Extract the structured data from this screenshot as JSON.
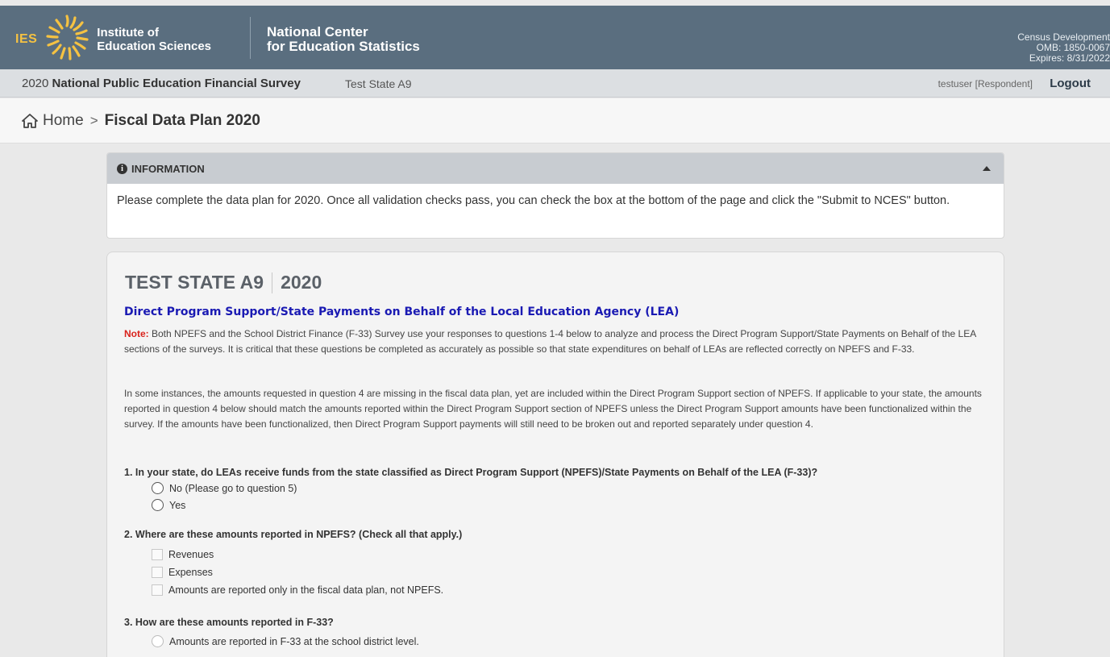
{
  "header": {
    "ies_letters": "IES",
    "ies_line1": "Institute of",
    "ies_line2": "Education Sciences",
    "nces_line1": "National Center",
    "nces_line2": "for Education Statistics",
    "omb_line1": "Census Development",
    "omb_line2": "OMB: 1850-0067",
    "omb_line3": "Expires: 8/31/2022",
    "brand_color": "#5a6e7f",
    "sun_color": "#f5c242"
  },
  "subbar": {
    "survey_year": "2020",
    "survey_name": "National Public Education Financial Survey",
    "state": "Test State A9",
    "user": "testuser [Respondent]",
    "logout": "Logout"
  },
  "breadcrumb": {
    "home": "Home",
    "separator": ">",
    "current": "Fiscal Data Plan 2020"
  },
  "info_panel": {
    "title": "INFORMATION",
    "text": "Please complete the data plan for 2020. Once all validation checks pass, you can check the box at the bottom of the page and click the \"Submit to NCES\" button."
  },
  "main": {
    "state_title": "TEST STATE A9",
    "year": "2020",
    "section_title": "Direct Program Support/State Payments on Behalf of the Local Education Agency (LEA)",
    "note_label": "Note:",
    "note_text": " Both NPEFS and the School District Finance (F-33) Survey use your responses to questions 1-4 below to analyze and process the Direct Program Support/State Payments on Behalf of the LEA sections of the surveys. It is critical that these questions be completed as accurately as possible so that state expenditures on behalf of LEAs are reflected correctly on NPEFS and F-33.",
    "paragraph2": "In some instances, the amounts requested in question 4 are missing in the fiscal data plan, yet are included within the Direct Program Support section of NPEFS. If applicable to your state, the amounts reported in question 4 below should match the amounts reported within the Direct Program Support section of NPEFS unless the Direct Program Support amounts have been functionalized within the survey. If the amounts have been functionalized, then Direct Program Support payments will still need to be broken out and reported separately under question 4.",
    "q1": {
      "text": "1. In your state, do LEAs receive funds from the state classified as Direct Program Support (NPEFS)/State Payments on Behalf of the LEA (F-33)?",
      "options": [
        "No (Please go to question 5)",
        "Yes"
      ]
    },
    "q2": {
      "text": "2. Where are these amounts reported in NPEFS? (Check all that apply.)",
      "options": [
        "Revenues",
        "Expenses",
        "Amounts are reported only in the fiscal data plan, not NPEFS."
      ]
    },
    "q3": {
      "text": "3. How are these amounts reported in F-33?",
      "options": [
        "Amounts are reported in F-33 at the school district level."
      ]
    }
  }
}
